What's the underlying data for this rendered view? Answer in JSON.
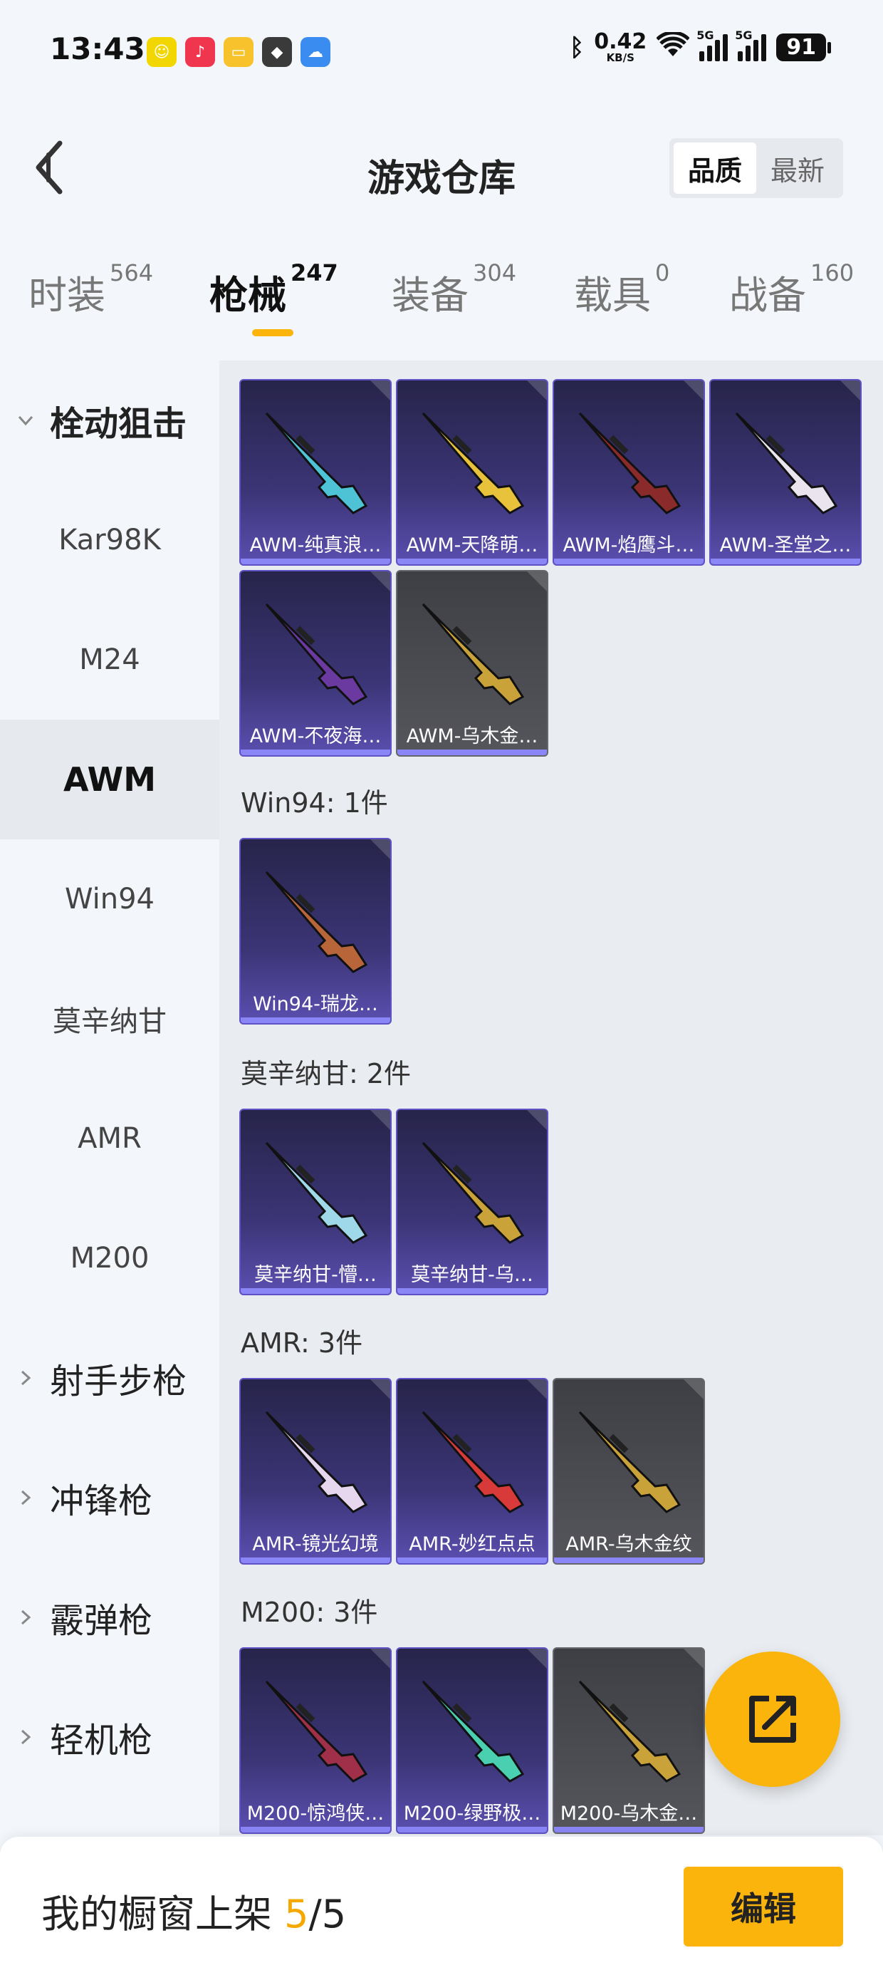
{
  "status_bar": {
    "time": "13:43",
    "net_speed_value": "0.42",
    "net_speed_unit": "KB/S",
    "signal_1_label": "5G",
    "signal_2_label": "5G",
    "battery": "91",
    "app_icons": [
      "game-app-icon",
      "music-app-icon",
      "notes-app-icon",
      "game-avatar-icon",
      "weather-icon"
    ]
  },
  "header": {
    "title": "游戏仓库",
    "sort_options": [
      "品质",
      "最新"
    ],
    "active_sort": "品质"
  },
  "tabs": [
    {
      "label": "时装",
      "count": "564"
    },
    {
      "label": "枪械",
      "count": "247"
    },
    {
      "label": "装备",
      "count": "304"
    },
    {
      "label": "载具",
      "count": "0"
    },
    {
      "label": "战备",
      "count": "160"
    }
  ],
  "active_tab": "枪械",
  "sidebar": {
    "group_open": "栓动狙击",
    "items": [
      "Kar98K",
      "M24",
      "AWM",
      "Win94",
      "莫辛纳甘",
      "AMR",
      "M200"
    ],
    "selected": "AWM",
    "groups_closed": [
      "射手步枪",
      "冲锋枪",
      "霰弹枪",
      "轻机枪"
    ]
  },
  "sections": {
    "awm": {
      "cards": [
        {
          "name": "AWM-纯真浪…",
          "rarity": "purple",
          "color": "#4fc3d6"
        },
        {
          "name": "AWM-天降萌…",
          "rarity": "purple",
          "color": "#e8c23a"
        },
        {
          "name": "AWM-焰鹰斗…",
          "rarity": "purple",
          "color": "#8a2a2a"
        },
        {
          "name": "AWM-圣堂之…",
          "rarity": "purple",
          "color": "#e9e4ee"
        },
        {
          "name": "AWM-不夜海…",
          "rarity": "purple",
          "color": "#6a3aa0"
        },
        {
          "name": "AWM-乌木金…",
          "rarity": "grey",
          "color": "#c9a23a"
        }
      ]
    },
    "win94": {
      "label": "Win94: 1件",
      "cards": [
        {
          "name": "Win94-瑞龙…",
          "rarity": "purple",
          "color": "#b8653a"
        }
      ]
    },
    "mosin": {
      "label": "莫辛纳甘: 2件",
      "cards": [
        {
          "name": "莫辛纳甘-懵…",
          "rarity": "purple",
          "color": "#9fd8e8"
        },
        {
          "name": "莫辛纳甘-乌…",
          "rarity": "purple",
          "color": "#c9a23a"
        }
      ]
    },
    "amr": {
      "label": "AMR: 3件",
      "cards": [
        {
          "name": "AMR-镜光幻境",
          "rarity": "purple",
          "color": "#e6d6ee"
        },
        {
          "name": "AMR-妙红点点",
          "rarity": "purple",
          "color": "#d83a3a"
        },
        {
          "name": "AMR-乌木金纹",
          "rarity": "grey",
          "color": "#c9a23a"
        }
      ]
    },
    "m200": {
      "label": "M200: 3件",
      "cards": [
        {
          "name": "M200-惊鸿侠…",
          "rarity": "purple",
          "color": "#a0304a"
        },
        {
          "name": "M200-绿野极…",
          "rarity": "purple",
          "color": "#4ad0b0"
        },
        {
          "name": "M200-乌木金…",
          "rarity": "grey",
          "color": "#c9a23a"
        }
      ]
    }
  },
  "bottom_bar": {
    "shelf_label": "我的橱窗上架 ",
    "shelf_current": "5",
    "shelf_sep_total": "/5",
    "edit_label": "编辑"
  },
  "colors": {
    "accent": "#fbb40b",
    "rarity_purple": "#5e52c4",
    "rarity_grey": "#66676c"
  }
}
